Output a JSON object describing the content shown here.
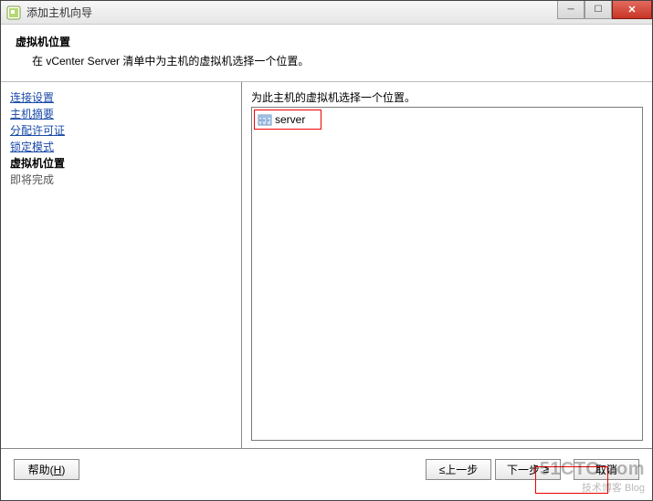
{
  "window": {
    "title": "添加主机向导"
  },
  "header": {
    "title": "虚拟机位置",
    "subtitle": "在 vCenter Server 清单中为主机的虚拟机选择一个位置。"
  },
  "sidebar": {
    "items": [
      {
        "label": "连接设置",
        "type": "link"
      },
      {
        "label": "主机摘要",
        "type": "link"
      },
      {
        "label": "分配许可证",
        "type": "link"
      },
      {
        "label": "锁定模式",
        "type": "link"
      },
      {
        "label": "虚拟机位置",
        "type": "current"
      },
      {
        "label": "即将完成",
        "type": "disabled"
      }
    ]
  },
  "content": {
    "prompt": "为此主机的虚拟机选择一个位置。",
    "tree": {
      "root": {
        "label": "server",
        "icon": "datacenter"
      }
    }
  },
  "footer": {
    "help": "帮助(H)",
    "back": "≤上一步",
    "next": "下一步",
    "cancel": "取消"
  },
  "watermark": {
    "main": "51CTO.com",
    "sub": "技术博客  Blog"
  }
}
